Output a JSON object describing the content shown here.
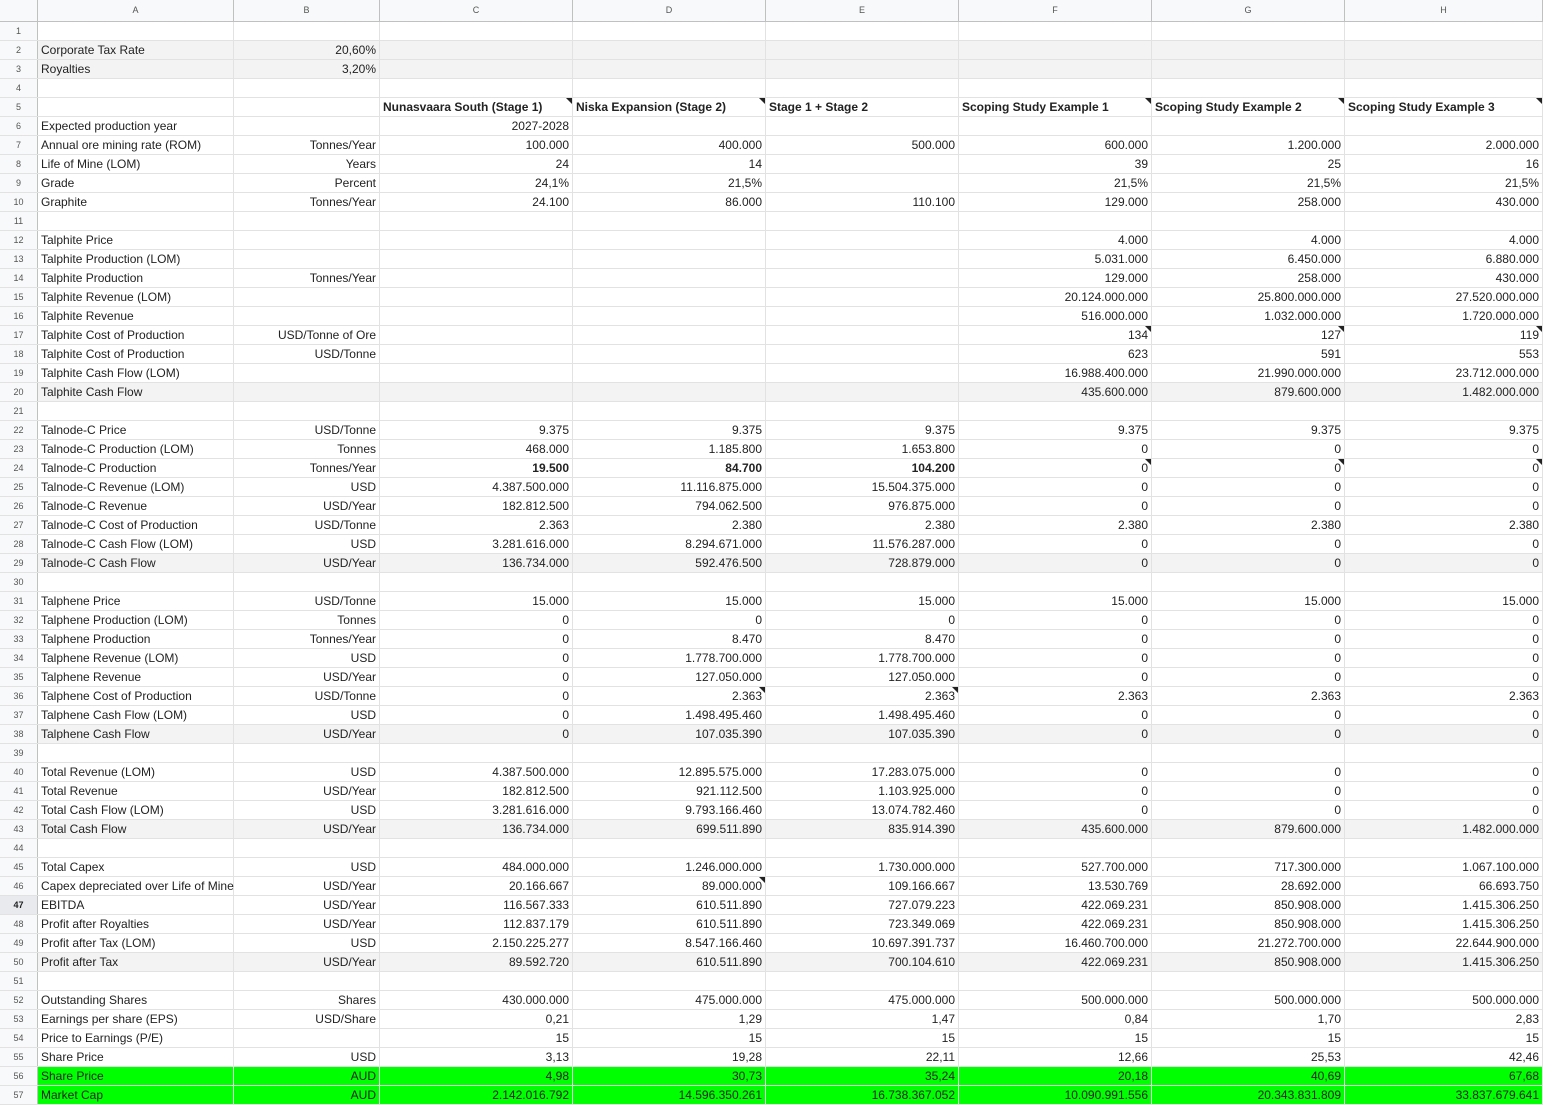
{
  "columns": [
    "A",
    "B",
    "C",
    "D",
    "E",
    "F",
    "G",
    "H"
  ],
  "rows": [
    {
      "n": "1",
      "cells": [
        "",
        "",
        "",
        "",
        "",
        "",
        "",
        ""
      ]
    },
    {
      "n": "2",
      "cells": [
        "Corporate Tax Rate",
        "20,60%",
        "",
        "",
        "",
        "",
        "",
        ""
      ],
      "shade": true
    },
    {
      "n": "3",
      "cells": [
        "Royalties",
        "3,20%",
        "",
        "",
        "",
        "",
        "",
        ""
      ],
      "shade": true
    },
    {
      "n": "4",
      "cells": [
        "",
        "",
        "",
        "",
        "",
        "",
        "",
        ""
      ]
    },
    {
      "n": "5",
      "cells": [
        "",
        "",
        "Nunasvaara South (Stage 1)",
        "Niska Expansion (Stage 2)",
        "Stage 1 + Stage 2",
        "Scoping Study Example 1",
        "Scoping Study Example 2",
        "Scoping Study Example 3"
      ],
      "header": true
    },
    {
      "n": "6",
      "cells": [
        "Expected production year",
        "",
        "2027-2028",
        "",
        "",
        "",
        "",
        ""
      ]
    },
    {
      "n": "7",
      "cells": [
        "Annual ore mining rate (ROM)",
        "Tonnes/Year",
        "100.000",
        "400.000",
        "500.000",
        "600.000",
        "1.200.000",
        "2.000.000"
      ]
    },
    {
      "n": "8",
      "cells": [
        "Life of Mine (LOM)",
        "Years",
        "24",
        "14",
        "",
        "39",
        "25",
        "16"
      ]
    },
    {
      "n": "9",
      "cells": [
        "Grade",
        "Percent",
        "24,1%",
        "21,5%",
        "",
        "21,5%",
        "21,5%",
        "21,5%"
      ]
    },
    {
      "n": "10",
      "cells": [
        "Graphite",
        "Tonnes/Year",
        "24.100",
        "86.000",
        "110.100",
        "129.000",
        "258.000",
        "430.000"
      ]
    },
    {
      "n": "11",
      "cells": [
        "",
        "",
        "",
        "",
        "",
        "",
        "",
        ""
      ]
    },
    {
      "n": "12",
      "cells": [
        "Talphite Price",
        "",
        "",
        "",
        "",
        "4.000",
        "4.000",
        "4.000"
      ]
    },
    {
      "n": "13",
      "cells": [
        "Talphite Production (LOM)",
        "",
        "",
        "",
        "",
        "5.031.000",
        "6.450.000",
        "6.880.000"
      ]
    },
    {
      "n": "14",
      "cells": [
        "Talphite Production",
        "Tonnes/Year",
        "",
        "",
        "",
        "129.000",
        "258.000",
        "430.000"
      ]
    },
    {
      "n": "15",
      "cells": [
        "Talphite Revenue (LOM)",
        "",
        "",
        "",
        "",
        "20.124.000.000",
        "25.800.000.000",
        "27.520.000.000"
      ]
    },
    {
      "n": "16",
      "cells": [
        "Talphite Revenue",
        "",
        "",
        "",
        "",
        "516.000.000",
        "1.032.000.000",
        "1.720.000.000"
      ]
    },
    {
      "n": "17",
      "cells": [
        "Talphite Cost of Production",
        "USD/Tonne of Ore",
        "",
        "",
        "",
        "134",
        "127",
        "119"
      ]
    },
    {
      "n": "18",
      "cells": [
        "Talphite Cost of Production",
        "USD/Tonne",
        "",
        "",
        "",
        "623",
        "591",
        "553"
      ]
    },
    {
      "n": "19",
      "cells": [
        "Talphite Cash Flow (LOM)",
        "",
        "",
        "",
        "",
        "16.988.400.000",
        "21.990.000.000",
        "23.712.000.000"
      ]
    },
    {
      "n": "20",
      "cells": [
        "Talphite Cash Flow",
        "",
        "",
        "",
        "",
        "435.600.000",
        "879.600.000",
        "1.482.000.000"
      ],
      "shade": true
    },
    {
      "n": "21",
      "cells": [
        "",
        "",
        "",
        "",
        "",
        "",
        "",
        ""
      ]
    },
    {
      "n": "22",
      "cells": [
        "Talnode-C Price",
        "USD/Tonne",
        "9.375",
        "9.375",
        "9.375",
        "9.375",
        "9.375",
        "9.375"
      ]
    },
    {
      "n": "23",
      "cells": [
        "Talnode-C Production (LOM)",
        "Tonnes",
        "468.000",
        "1.185.800",
        "1.653.800",
        "0",
        "0",
        "0"
      ]
    },
    {
      "n": "24",
      "cells": [
        "Talnode-C Production",
        "Tonnes/Year",
        "19.500",
        "84.700",
        "104.200",
        "0",
        "0",
        "0"
      ],
      "bold": true
    },
    {
      "n": "25",
      "cells": [
        "Talnode-C Revenue (LOM)",
        "USD",
        "4.387.500.000",
        "11.116.875.000",
        "15.504.375.000",
        "0",
        "0",
        "0"
      ]
    },
    {
      "n": "26",
      "cells": [
        "Talnode-C Revenue",
        "USD/Year",
        "182.812.500",
        "794.062.500",
        "976.875.000",
        "0",
        "0",
        "0"
      ]
    },
    {
      "n": "27",
      "cells": [
        "Talnode-C Cost of Production",
        "USD/Tonne",
        "2.363",
        "2.380",
        "2.380",
        "2.380",
        "2.380",
        "2.380"
      ]
    },
    {
      "n": "28",
      "cells": [
        "Talnode-C Cash Flow (LOM)",
        "USD",
        "3.281.616.000",
        "8.294.671.000",
        "11.576.287.000",
        "0",
        "0",
        "0"
      ]
    },
    {
      "n": "29",
      "cells": [
        "Talnode-C Cash Flow",
        "USD/Year",
        "136.734.000",
        "592.476.500",
        "728.879.000",
        "0",
        "0",
        "0"
      ],
      "shade": true
    },
    {
      "n": "30",
      "cells": [
        "",
        "",
        "",
        "",
        "",
        "",
        "",
        ""
      ]
    },
    {
      "n": "31",
      "cells": [
        "Talphene Price",
        "USD/Tonne",
        "15.000",
        "15.000",
        "15.000",
        "15.000",
        "15.000",
        "15.000"
      ]
    },
    {
      "n": "32",
      "cells": [
        "Talphene Production (LOM)",
        "Tonnes",
        "0",
        "0",
        "0",
        "0",
        "0",
        "0"
      ]
    },
    {
      "n": "33",
      "cells": [
        "Talphene Production",
        "Tonnes/Year",
        "0",
        "8.470",
        "8.470",
        "0",
        "0",
        "0"
      ]
    },
    {
      "n": "34",
      "cells": [
        "Talphene Revenue (LOM)",
        "USD",
        "0",
        "1.778.700.000",
        "1.778.700.000",
        "0",
        "0",
        "0"
      ]
    },
    {
      "n": "35",
      "cells": [
        "Talphene Revenue",
        "USD/Year",
        "0",
        "127.050.000",
        "127.050.000",
        "0",
        "0",
        "0"
      ]
    },
    {
      "n": "36",
      "cells": [
        "Talphene Cost of Production",
        "USD/Tonne",
        "0",
        "2.363",
        "2.363",
        "2.363",
        "2.363",
        "2.363"
      ]
    },
    {
      "n": "37",
      "cells": [
        "Talphene Cash Flow (LOM)",
        "USD",
        "0",
        "1.498.495.460",
        "1.498.495.460",
        "0",
        "0",
        "0"
      ]
    },
    {
      "n": "38",
      "cells": [
        "Talphene Cash Flow",
        "USD/Year",
        "0",
        "107.035.390",
        "107.035.390",
        "0",
        "0",
        "0"
      ],
      "shade": true
    },
    {
      "n": "39",
      "cells": [
        "",
        "",
        "",
        "",
        "",
        "",
        "",
        ""
      ]
    },
    {
      "n": "40",
      "cells": [
        "Total Revenue (LOM)",
        "USD",
        "4.387.500.000",
        "12.895.575.000",
        "17.283.075.000",
        "0",
        "0",
        "0"
      ]
    },
    {
      "n": "41",
      "cells": [
        "Total Revenue",
        "USD/Year",
        "182.812.500",
        "921.112.500",
        "1.103.925.000",
        "0",
        "0",
        "0"
      ]
    },
    {
      "n": "42",
      "cells": [
        "Total Cash Flow (LOM)",
        "USD",
        "3.281.616.000",
        "9.793.166.460",
        "13.074.782.460",
        "0",
        "0",
        "0"
      ]
    },
    {
      "n": "43",
      "cells": [
        "Total Cash Flow",
        "USD/Year",
        "136.734.000",
        "699.511.890",
        "835.914.390",
        "435.600.000",
        "879.600.000",
        "1.482.000.000"
      ],
      "shade": true
    },
    {
      "n": "44",
      "cells": [
        "",
        "",
        "",
        "",
        "",
        "",
        "",
        ""
      ]
    },
    {
      "n": "45",
      "cells": [
        "Total Capex",
        "USD",
        "484.000.000",
        "1.246.000.000",
        "1.730.000.000",
        "527.700.000",
        "717.300.000",
        "1.067.100.000"
      ]
    },
    {
      "n": "46",
      "cells": [
        "Capex depreciated over Life of Mine",
        "USD/Year",
        "20.166.667",
        "89.000.000",
        "109.166.667",
        "13.530.769",
        "28.692.000",
        "66.693.750"
      ]
    },
    {
      "n": "47",
      "cells": [
        "EBITDA",
        "USD/Year",
        "116.567.333",
        "610.511.890",
        "727.079.223",
        "422.069.231",
        "850.908.000",
        "1.415.306.250"
      ],
      "sel": true
    },
    {
      "n": "48",
      "cells": [
        "Profit after Royalties",
        "USD/Year",
        "112.837.179",
        "610.511.890",
        "723.349.069",
        "422.069.231",
        "850.908.000",
        "1.415.306.250"
      ]
    },
    {
      "n": "49",
      "cells": [
        "Profit after Tax (LOM)",
        "USD",
        "2.150.225.277",
        "8.547.166.460",
        "10.697.391.737",
        "16.460.700.000",
        "21.272.700.000",
        "22.644.900.000"
      ]
    },
    {
      "n": "50",
      "cells": [
        "Profit after Tax",
        "USD/Year",
        "89.592.720",
        "610.511.890",
        "700.104.610",
        "422.069.231",
        "850.908.000",
        "1.415.306.250"
      ],
      "shade": true
    },
    {
      "n": "51",
      "cells": [
        "",
        "",
        "",
        "",
        "",
        "",
        "",
        ""
      ]
    },
    {
      "n": "52",
      "cells": [
        "Outstanding Shares",
        "Shares",
        "430.000.000",
        "475.000.000",
        "475.000.000",
        "500.000.000",
        "500.000.000",
        "500.000.000"
      ]
    },
    {
      "n": "53",
      "cells": [
        "Earnings per share (EPS)",
        "USD/Share",
        "0,21",
        "1,29",
        "1,47",
        "0,84",
        "1,70",
        "2,83"
      ]
    },
    {
      "n": "54",
      "cells": [
        "Price to Earnings (P/E)",
        "",
        "15",
        "15",
        "15",
        "15",
        "15",
        "15"
      ]
    },
    {
      "n": "55",
      "cells": [
        "Share Price",
        "USD",
        "3,13",
        "19,28",
        "22,11",
        "12,66",
        "25,53",
        "42,46"
      ]
    },
    {
      "n": "56",
      "cells": [
        "Share Price",
        "AUD",
        "4,98",
        "30,73",
        "35,24",
        "20,18",
        "40,69",
        "67,68"
      ],
      "green": true
    },
    {
      "n": "57",
      "cells": [
        "Market Cap",
        "AUD",
        "2.142.016.792",
        "14.596.350.261",
        "16.738.367.052",
        "10.090.991.556",
        "20.343.831.809",
        "33.837.679.641"
      ],
      "green": true
    }
  ],
  "colors": {
    "green_fill": "#00ff00",
    "shade_fill": "#f3f3f3",
    "grid": "#e2e2e2",
    "header_bg": "#f8f9fa"
  }
}
